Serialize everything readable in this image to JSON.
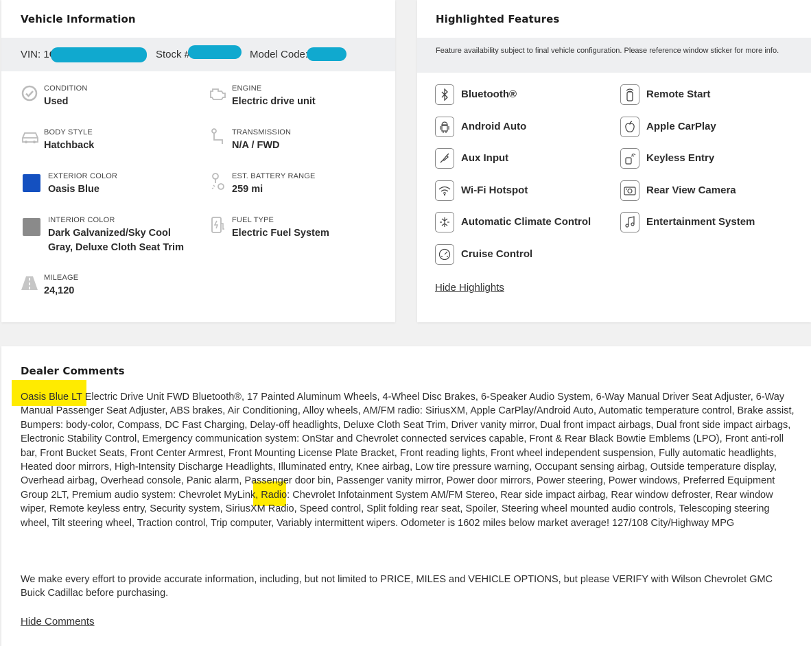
{
  "vehicle": {
    "title": "Vehicle Information",
    "vin_label": "VIN: 1",
    "vin_prefix": "C",
    "stock_label": "Stock #",
    "model_code_label": "Model Code:",
    "specs": {
      "condition": {
        "label": "CONDITION",
        "value": "Used",
        "icon": "check-circle-icon"
      },
      "engine": {
        "label": "ENGINE",
        "value": "Electric drive unit",
        "icon": "engine-icon"
      },
      "body_style": {
        "label": "BODY STYLE",
        "value": "Hatchback",
        "icon": "car-icon"
      },
      "transmission": {
        "label": "TRANSMISSION",
        "value": "N/A / FWD",
        "icon": "transmission-icon"
      },
      "exterior_color": {
        "label": "EXTERIOR COLOR",
        "value": "Oasis Blue",
        "swatch": "#1450c0"
      },
      "battery_range": {
        "label": "EST. BATTERY RANGE",
        "value": "259 mi",
        "icon": "battery-range-icon"
      },
      "interior_color": {
        "label": "INTERIOR COLOR",
        "value_line1": "Dark Galvanized/Sky Cool",
        "value_line2": "Gray, Deluxe Cloth Seat Trim",
        "swatch": "#8a8a8a"
      },
      "fuel_type": {
        "label": "FUEL TYPE",
        "value": "Electric Fuel System",
        "icon": "ev-charger-icon"
      },
      "mileage": {
        "label": "MILEAGE",
        "value": "24,120",
        "icon": "road-icon"
      }
    }
  },
  "features": {
    "title": "Highlighted Features",
    "note": "Feature availability subject to final vehicle configuration. Please reference window sticker for more info.",
    "items": [
      {
        "label": "Bluetooth®",
        "icon": "bluetooth-icon"
      },
      {
        "label": "Remote Start",
        "icon": "remote-icon"
      },
      {
        "label": "Android Auto",
        "icon": "android-icon"
      },
      {
        "label": "Apple CarPlay",
        "icon": "apple-icon"
      },
      {
        "label": "Aux Input",
        "icon": "aux-icon"
      },
      {
        "label": "Keyless Entry",
        "icon": "key-icon"
      },
      {
        "label": "Wi-Fi Hotspot",
        "icon": "wifi-icon"
      },
      {
        "label": "Rear View Camera",
        "icon": "camera-icon"
      },
      {
        "label": "Automatic Climate Control",
        "icon": "climate-icon"
      },
      {
        "label": "Entertainment System",
        "icon": "music-icon"
      },
      {
        "label": "Cruise Control",
        "icon": "gauge-icon"
      }
    ],
    "hide_link": "Hide Highlights"
  },
  "comments": {
    "title": "Dealer Comments",
    "body": "Oasis Blue LT Electric Drive Unit FWD Bluetooth®, 17 Painted Aluminum Wheels, 4-Wheel Disc Brakes, 6-Speaker Audio System, 6-Way Manual Driver Seat Adjuster, 6-Way Manual Passenger Seat Adjuster, ABS brakes, Air Conditioning, Alloy wheels, AM/FM radio: SiriusXM, Apple CarPlay/Android Auto, Automatic temperature control, Brake assist, Bumpers: body-color, Compass, DC Fast Charging, Delay-off headlights, Deluxe Cloth Seat Trim, Driver vanity mirror, Dual front impact airbags, Dual front side impact airbags, Electronic Stability Control, Emergency communication system: OnStar and Chevrolet connected services capable, Front & Rear Black Bowtie Emblems (LPO), Front anti-roll bar, Front Bucket Seats, Front Center Armrest, Front Mounting License Plate Bracket, Front reading lights, Front wheel independent suspension, Fully automatic headlights, Heated door mirrors, High-Intensity Discharge Headlights, Illuminated entry, Knee airbag, Low tire pressure warning, Occupant sensing airbag, Outside temperature display, Overhead airbag, Overhead console, Panic alarm, Passenger door bin, Passenger vanity mirror, Power door mirrors, Power steering, Power windows, Preferred Equipment Group 2LT, Premium audio system: Chevrolet MyLink, Radio: Chevrolet Infotainment System AM/FM Stereo, Rear side impact airbag, Rear window defroster, Rear window wiper, Remote keyless entry, Security system, SiriusXM Radio, Speed control, Split folding rear seat, Spoiler, Steering wheel mounted audio controls, Telescoping steering wheel, Tilt steering wheel, Traction control, Trip computer, Variably intermittent wipers. Odometer is 1602 miles below market average! 127/108 City/Highway MPG",
    "disclaimer": "We make every effort to provide accurate information, including, but not limited to PRICE, MILES and VEHICLE OPTIONS, but please VERIFY with Wilson Chevrolet GMC Buick Cadillac before purchasing.",
    "hide_link": "Hide Comments",
    "highlight_color": "#ffeb00",
    "redaction_color": "#10a9cf"
  }
}
